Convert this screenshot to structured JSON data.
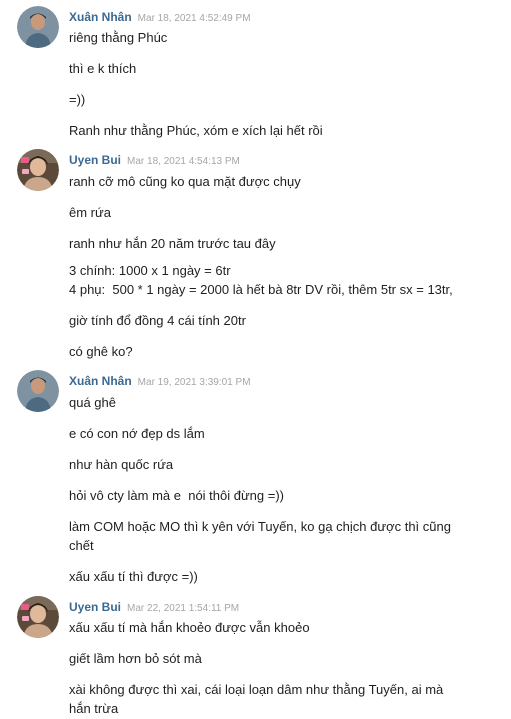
{
  "groups": [
    {
      "author": "Xuân Nhân",
      "timestamp": "Mar 18, 2021 4:52:49 PM",
      "avatar_icon": "user-avatar-icon",
      "messages": [
        "riêng thằng Phúc",
        "thì e k thích",
        "=))",
        "Ranh như thằng Phúc, xóm e xích lại hết rồi"
      ]
    },
    {
      "author": "Uyen Bui",
      "timestamp": "Mar 18, 2021 4:54:13 PM",
      "avatar_icon": "user-avatar-icon",
      "messages": [
        "ranh cỡ mô cũng ko qua mặt được chụy",
        "êm rứa",
        "ranh như hắn 20 năm trước tau đây",
        "3 chính: 1000 x 1 ngày = 6tr\n4 phụ:  500 * 1 ngày = 2000 là hết bà 8tr DV rồi, thêm 5tr sx = 13tr,",
        "giờ tính đổ đồng 4 cái tính 20tr",
        "có ghê ko?"
      ]
    },
    {
      "author": "Xuân Nhân",
      "timestamp": "Mar 19, 2021 3:39:01 PM",
      "avatar_icon": "user-avatar-icon",
      "messages": [
        "quá ghê",
        "e có con nớ đẹp ds lắm",
        "như hàn quốc rứa",
        "hỏi vô cty làm mà e  nói thôi đừng =))",
        "làm COM hoặc MO thì k yên với Tuyến, ko gạ chịch được thì cũng chết",
        "xấu xấu tí thì được =))"
      ]
    },
    {
      "author": "Uyen Bui",
      "timestamp": "Mar 22, 2021 1:54:11 PM",
      "avatar_icon": "user-avatar-icon",
      "messages": [
        "xấu xấu tí mà hắn khoẻo được vẫn khoẻo",
        "giết lầm hơn bỏ sót mà",
        "xài không được thì xai, cái loại loạn dâm như thằng Tuyến, ai mà hắn trừa"
      ]
    }
  ]
}
